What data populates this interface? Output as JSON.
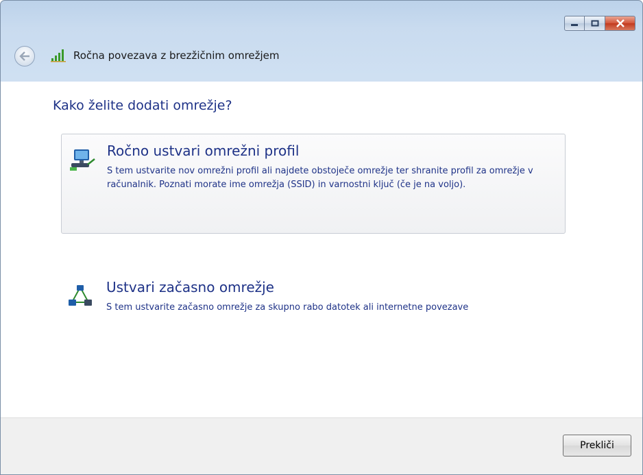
{
  "window": {
    "title": "Ročna povezava z brezžičnim omrežjem",
    "icons": {
      "back": "back-arrow-icon",
      "signal": "wifi-signal-icon",
      "minimize": "minimize-icon",
      "maximize": "maximize-icon",
      "close": "close-icon"
    }
  },
  "content": {
    "heading": "Kako želite dodati omrežje?",
    "options": [
      {
        "icon": "network-computer-icon",
        "title": "Ročno ustvari omrežni profil",
        "description": "S tem ustvarite nov omrežni profil ali najdete obstoječe omrežje ter shranite profil za omrežje v računalnik. Poznati morate ime omrežja (SSID) in varnostni ključ (če je na voljo)."
      },
      {
        "icon": "adhoc-network-icon",
        "title": "Ustvari začasno omrežje",
        "description": "S tem ustvarite začasno omrežje za skupno rabo datotek ali internetne povezave"
      }
    ]
  },
  "footer": {
    "cancel_label": "Prekliči"
  },
  "colors": {
    "link_blue": "#1e3287",
    "title_bar": "#c9dbef",
    "footer_bg": "#f0f0f0"
  }
}
